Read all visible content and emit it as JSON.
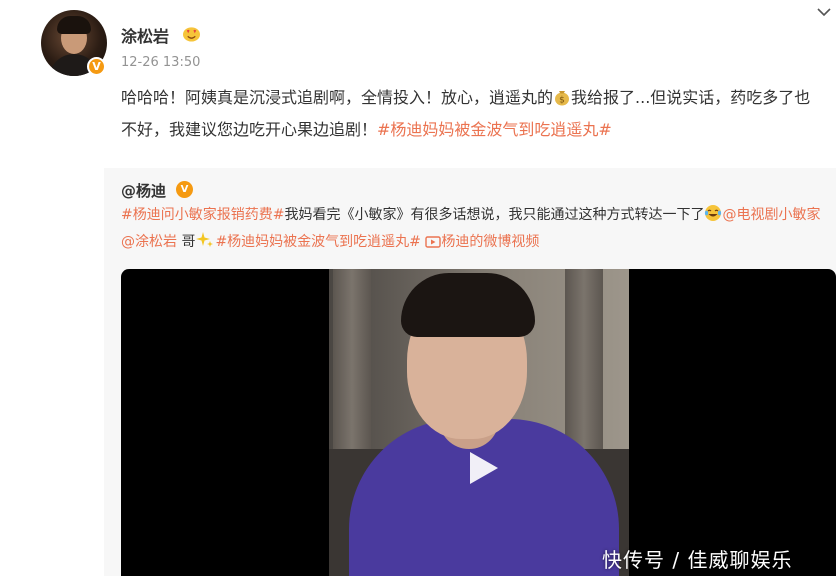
{
  "post": {
    "author": "涂松岩",
    "timestamp": "12-26 13:50",
    "text_1": "哈哈哈！阿姨真是沉浸式追剧啊，全情投入！放心，逍遥丸的",
    "text_2": "我给报了...但说实话，药吃多了也不好，我建议您边吃开心果边追剧！",
    "hashtag": "#杨迪妈妈被金波气到吃逍遥丸#"
  },
  "repost": {
    "author": "@杨迪",
    "hashtag_1": "#杨迪问小敏家报销药费#",
    "text_1": "我妈看完《小敏家》有很多话想说，我只能通过这种方式转达一下了",
    "mention_1": "@电视剧小敏家",
    "mention_2": "@涂松岩",
    "text_2": "哥",
    "hashtag_2": "#杨迪妈妈被金波气到吃逍遥丸#",
    "video_link": "杨迪的微博视频"
  },
  "watermark": "快传号 / 佳威聊娱乐",
  "colors": {
    "accent_link": "#eb7350",
    "verified_badge": "#f59a12",
    "timestamp": "#939393",
    "repost_bg": "#f7f7f7"
  },
  "icons": {
    "verified": "verified-v-icon",
    "heart_eyes": "heart-eyes-emoji-icon",
    "money_bag": "money-bag-emoji-icon",
    "laugh_cry": "laugh-cry-emoji-icon",
    "sparkle": "sparkle-emoji-icon",
    "video": "video-link-icon",
    "play": "play-icon",
    "menu": "chevron-down-icon"
  }
}
